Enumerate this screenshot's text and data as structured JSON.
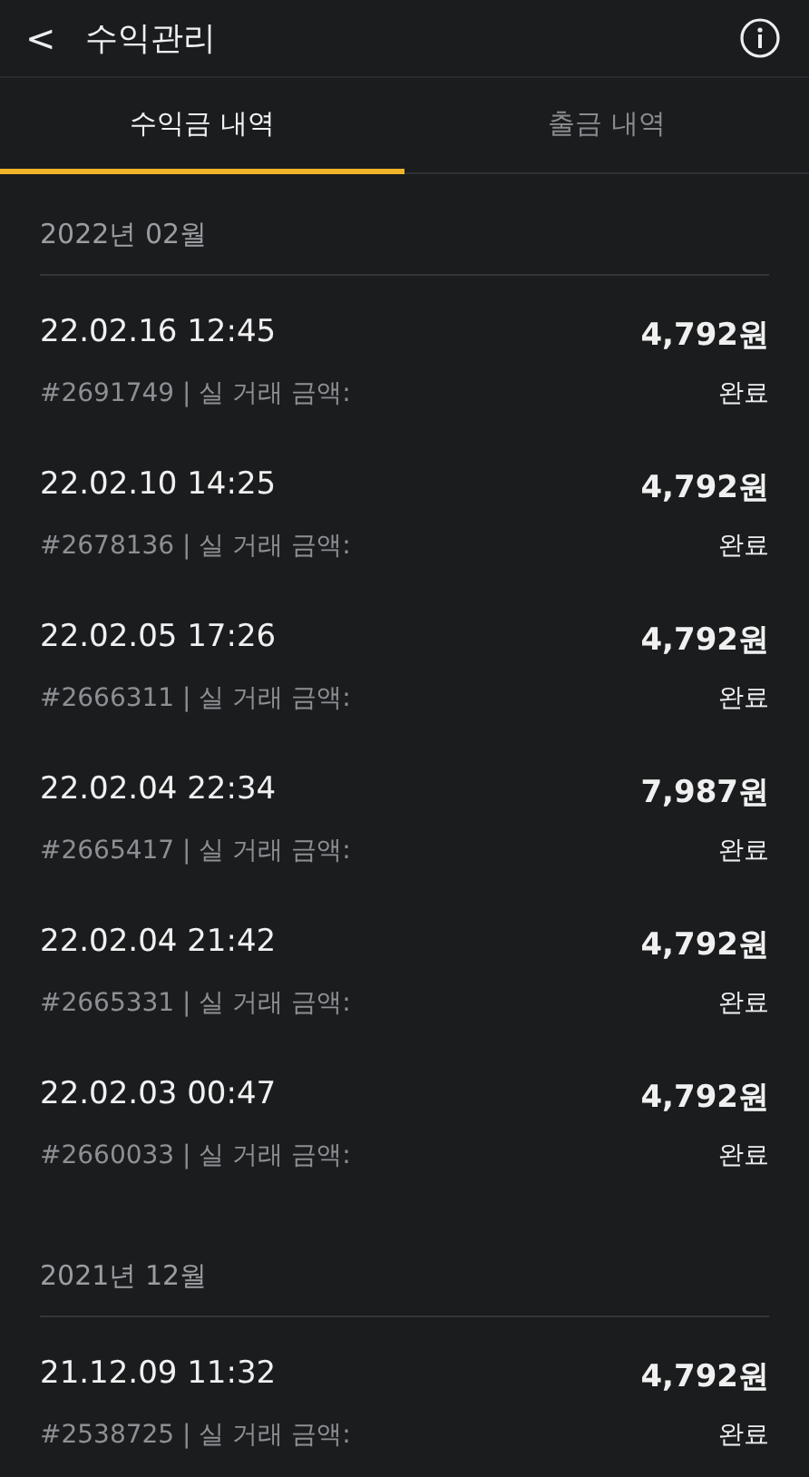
{
  "header": {
    "back": "<",
    "title": "수익관리"
  },
  "tabs": [
    {
      "label": "수익금 내역",
      "selected": true
    },
    {
      "label": "출금 내역",
      "selected": false
    }
  ],
  "groups": [
    {
      "month": "2022년 02월",
      "rows": [
        {
          "datetime": "22.02.16 12:45",
          "amount": "4,792원",
          "detail": "#2691749 | 실 거래 금액:",
          "status": "완료"
        },
        {
          "datetime": "22.02.10 14:25",
          "amount": "4,792원",
          "detail": "#2678136 | 실 거래 금액:",
          "status": "완료"
        },
        {
          "datetime": "22.02.05 17:26",
          "amount": "4,792원",
          "detail": "#2666311 | 실 거래 금액:",
          "status": "완료"
        },
        {
          "datetime": "22.02.04 22:34",
          "amount": "7,987원",
          "detail": "#2665417 | 실 거래 금액:",
          "status": "완료"
        },
        {
          "datetime": "22.02.04 21:42",
          "amount": "4,792원",
          "detail": "#2665331 | 실 거래 금액:",
          "status": "완료"
        },
        {
          "datetime": "22.02.03 00:47",
          "amount": "4,792원",
          "detail": "#2660033 | 실 거래 금액:",
          "status": "완료"
        }
      ]
    },
    {
      "month": "2021년 12월",
      "rows": [
        {
          "datetime": "21.12.09 11:32",
          "amount": "4,792원",
          "detail": "#2538725 | 실 거래 금액:",
          "status": "완료"
        }
      ]
    }
  ]
}
